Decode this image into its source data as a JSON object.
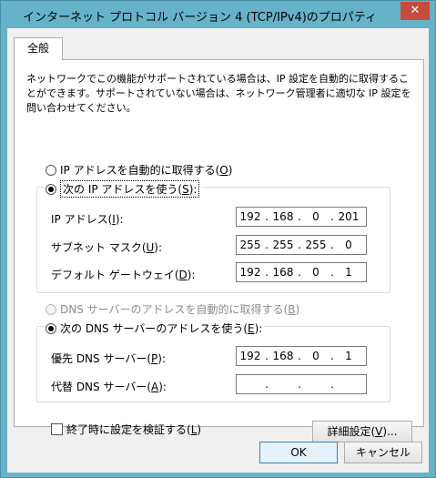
{
  "window": {
    "title": "インターネット プロトコル バージョン 4 (TCP/IPv4)のプロパティ",
    "close_glyph": "✕"
  },
  "tab": {
    "label": "全般"
  },
  "description": "ネットワークでこの機能がサポートされている場合は、IP 設定を自動的に取得することができます。サポートされていない場合は、ネットワーク管理者に適切な IP 設定を問い合わせてください。",
  "ip_section": {
    "auto_label_pre": "IP アドレスを自動的に取得する(",
    "auto_key": "O",
    "auto_label_post": ")",
    "manual_label_pre": "次の IP アドレスを使う(",
    "manual_key": "S",
    "manual_label_post": "):",
    "fields": [
      {
        "label_pre": "IP アドレス(",
        "key": "I",
        "label_post": "):",
        "octets": [
          "192",
          "168",
          "0",
          "201"
        ]
      },
      {
        "label_pre": "サブネット マスク(",
        "key": "U",
        "label_post": "):",
        "octets": [
          "255",
          "255",
          "255",
          "0"
        ]
      },
      {
        "label_pre": "デフォルト ゲートウェイ(",
        "key": "D",
        "label_post": "):",
        "octets": [
          "192",
          "168",
          "0",
          "1"
        ]
      }
    ]
  },
  "dns_section": {
    "auto_label_pre": "DNS サーバーのアドレスを自動的に取得する(",
    "auto_key": "B",
    "auto_label_post": ")",
    "manual_label_pre": "次の DNS サーバーのアドレスを使う(",
    "manual_key": "E",
    "manual_label_post": "):",
    "fields": [
      {
        "label_pre": "優先 DNS サーバー(",
        "key": "P",
        "label_post": "):",
        "octets": [
          "192",
          "168",
          "0",
          "1"
        ]
      },
      {
        "label_pre": "代替 DNS サーバー(",
        "key": "A",
        "label_post": "):",
        "octets": [
          "",
          "",
          "",
          ""
        ]
      }
    ]
  },
  "validate": {
    "label_pre": "終了時に設定を検証する(",
    "key": "L",
    "label_post": ")"
  },
  "buttons": {
    "advanced_pre": "詳細設定(",
    "advanced_key": "V",
    "advanced_post": ")...",
    "ok": "OK",
    "cancel": "キャンセル"
  }
}
